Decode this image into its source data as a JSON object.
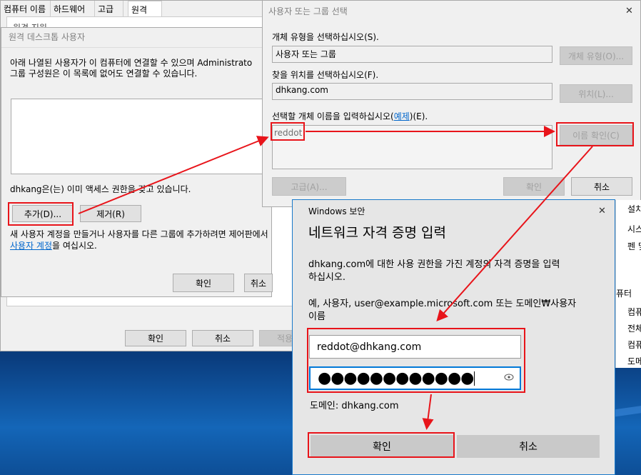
{
  "system_properties": {
    "tabs": [
      "컴퓨터 이름",
      "하드웨어",
      "고급",
      "원격"
    ],
    "active_tab": "원격",
    "partial_text": "원격 지원",
    "ok_label": "확인",
    "cancel_label": "취소",
    "apply_label": "적용"
  },
  "remote_desktop_users": {
    "title": "원격 데스크톱 사용자",
    "desc_line1": "아래 나열된 사용자가 이 컴퓨터에 연결할 수 있으며 Administrato",
    "desc_line2": "그룹 구성원은 이 목록에 없어도 연결할 수 있습니다.",
    "access_text": "dhkang은(는) 이미 액세스 권한을 갖고 있습니다.",
    "add_label": "추가(D)...",
    "remove_label": "제거(R)",
    "footer_line1": "새 사용자 계정을 만들거나 사용자를 다른 그룹에 추가하려면 제어판에서",
    "footer_link": "사용자 계정",
    "footer_line2": "을 여십시오.",
    "ok_label": "확인",
    "cancel_label": "취소"
  },
  "select_users": {
    "title": "사용자 또는 그룹 선택",
    "object_type_label": "개체 유형을 선택하십시오(S).",
    "object_type_value": "사용자 또는 그룹",
    "object_type_button": "개체 유형(O)...",
    "location_label": "찾을 위치를 선택하십시오(F).",
    "location_value": "dhkang.com",
    "location_button": "위치(L)...",
    "names_label_pre": "선택할 개체 이름을 입력하십시오(",
    "names_label_link": "예제",
    "names_label_post": ")(E).",
    "names_value": "reddot",
    "check_names_button": "이름 확인(C)",
    "advanced_button": "고급(A)...",
    "ok_label": "확인",
    "cancel_label": "취소",
    "close_symbol": "✕"
  },
  "windows_security": {
    "header": "Windows 보안",
    "heading": "네트워크 자격 증명 입력",
    "desc_line1": "dhkang.com에 대한 사용 권한을 가진 계정의 자격 증명을 입력",
    "desc_line2": "하십시오.",
    "example_line1": "예, 사용자, user@example.microsoft.com  또는  도메인₩사용자",
    "example_line2": "이름",
    "username_value": "reddot@dhkang.com",
    "password_masked": "●●●●●●●●●●●●",
    "domain_text": "도메인: dhkang.com",
    "ok_label": "확인",
    "cancel_label": "취소",
    "close_symbol": "✕"
  },
  "right_partial_window": {
    "items": [
      "설치",
      "시스",
      "펜 및",
      "퓨터",
      "컴퓨",
      "전체",
      "컴퓨",
      "도메"
    ]
  },
  "colors": {
    "annotation_red": "#e8141a",
    "focus_blue": "#0078d7"
  }
}
